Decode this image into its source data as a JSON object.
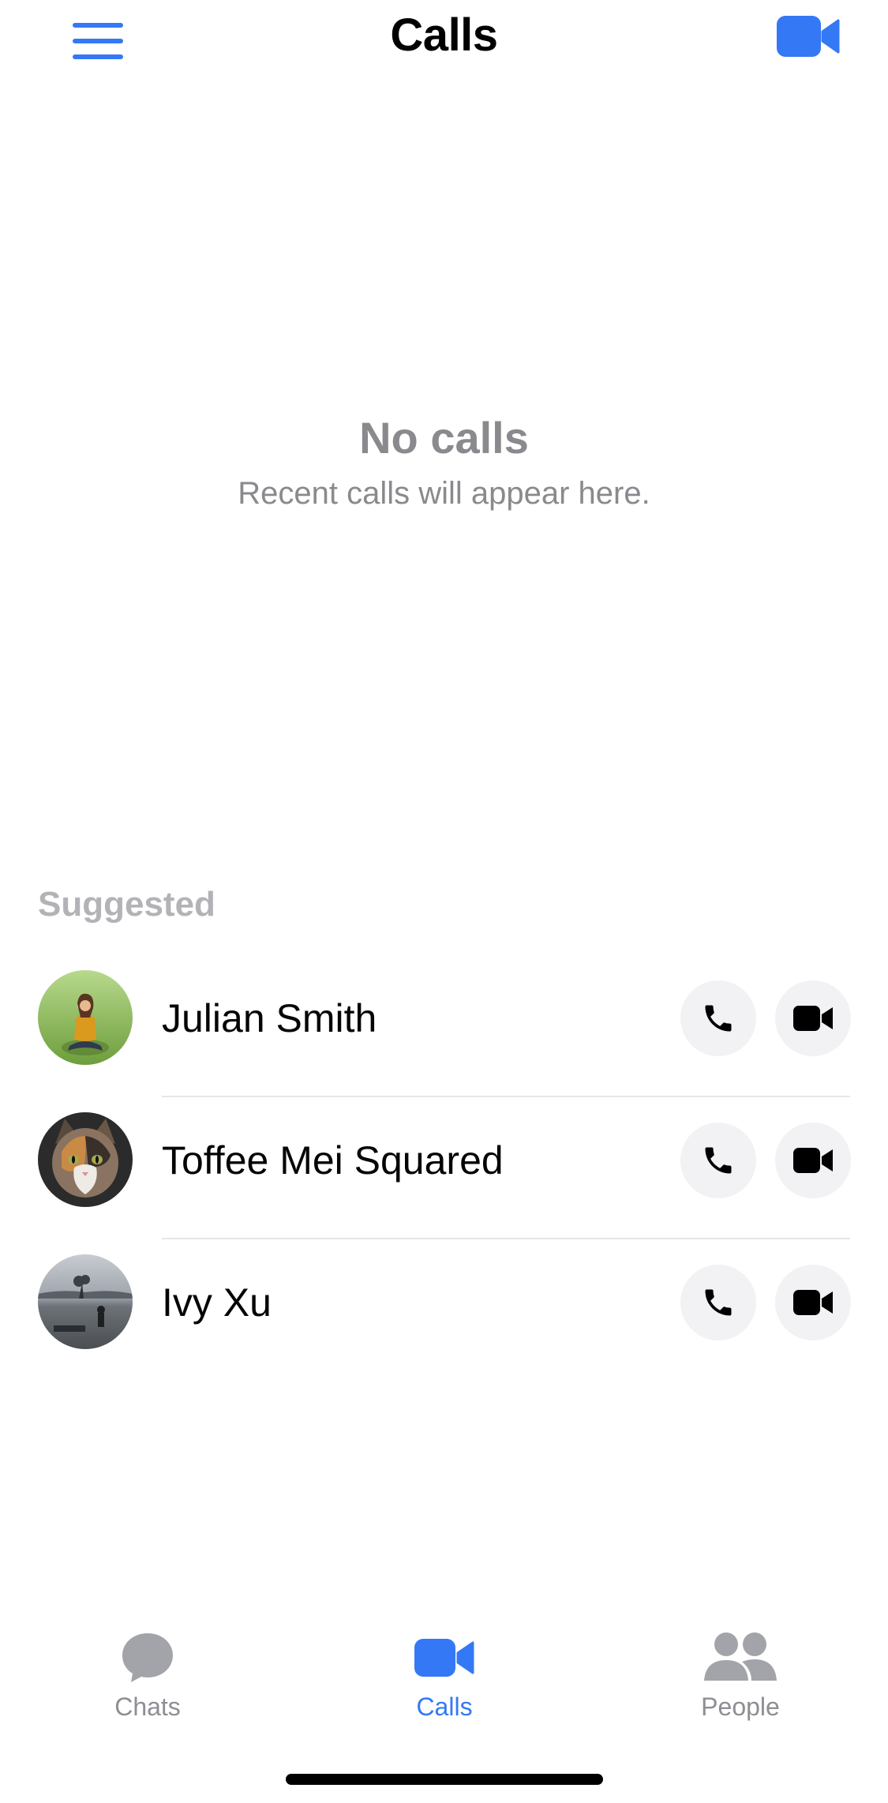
{
  "header": {
    "title": "Calls",
    "menu_icon": "hamburger-menu-icon",
    "action_icon": "video-camera-icon"
  },
  "empty_state": {
    "title": "No calls",
    "subtitle": "Recent calls will appear here."
  },
  "suggested": {
    "title": "Suggested",
    "contacts": [
      {
        "name": "Julian Smith",
        "avatar": "photo-woman-on-grass"
      },
      {
        "name": "Toffee Mei Squared",
        "avatar": "photo-cat"
      },
      {
        "name": "Ivy Xu",
        "avatar": "photo-lake-tree"
      }
    ],
    "audio_call_icon": "phone-icon",
    "video_call_icon": "video-camera-icon"
  },
  "tabbar": {
    "tabs": [
      {
        "label": "Chats",
        "icon": "chat-bubble-icon",
        "active": false
      },
      {
        "label": "Calls",
        "icon": "video-camera-icon",
        "active": true
      },
      {
        "label": "People",
        "icon": "people-icon",
        "active": false
      }
    ]
  },
  "colors": {
    "accent": "#3478f6",
    "muted_text": "#8a8a8e",
    "section_title": "#b3b3b7",
    "button_bg": "#f2f2f4",
    "inactive_tab": "#8e8e93"
  }
}
